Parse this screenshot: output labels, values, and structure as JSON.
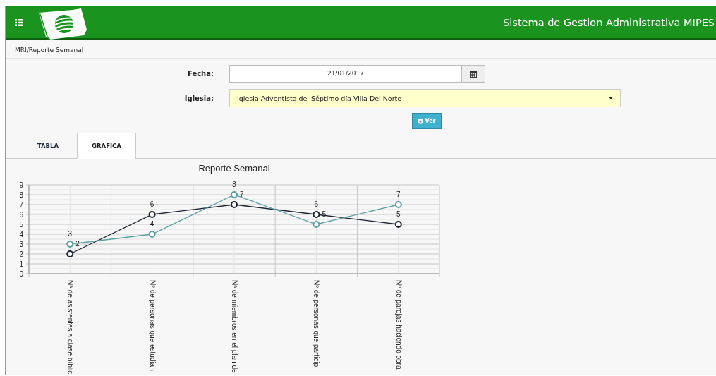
{
  "header": {
    "title": "Sistema de Gestion Administrativa MIPES"
  },
  "breadcrumb": "MRI/Reporte Semanal",
  "form": {
    "fecha": {
      "label": "Fecha:",
      "value": "21/01/2017"
    },
    "iglesia": {
      "label": "Iglesia:",
      "value": "Iglesia Adventista del Séptimo día Villa Del Norte"
    },
    "button": "Ver"
  },
  "tabs": [
    {
      "label": "TABLA",
      "selected": false
    },
    {
      "label": "GRAFICA",
      "selected": true
    }
  ],
  "chart_data": {
    "type": "line",
    "title": "Reporte Semanal",
    "categories": [
      "Nª de asistentes a clase bíblic",
      "Nº de personas que estudian",
      "Nª de miembros en el plan de",
      "Nº de personas que particip",
      "Nº de parejas haciendo obra"
    ],
    "series": [
      {
        "color": "#1c2433",
        "marker": "circle",
        "values": [
          2,
          6,
          7,
          6,
          5
        ]
      },
      {
        "color": "#5b9ea6",
        "marker": "circle",
        "values": [
          3,
          4,
          8,
          5,
          7
        ]
      }
    ],
    "grid": true,
    "ylim": [
      0,
      9
    ],
    "yticks": [
      0,
      1,
      2,
      3,
      4,
      5,
      6,
      7,
      8,
      9
    ],
    "data_labels": true
  }
}
